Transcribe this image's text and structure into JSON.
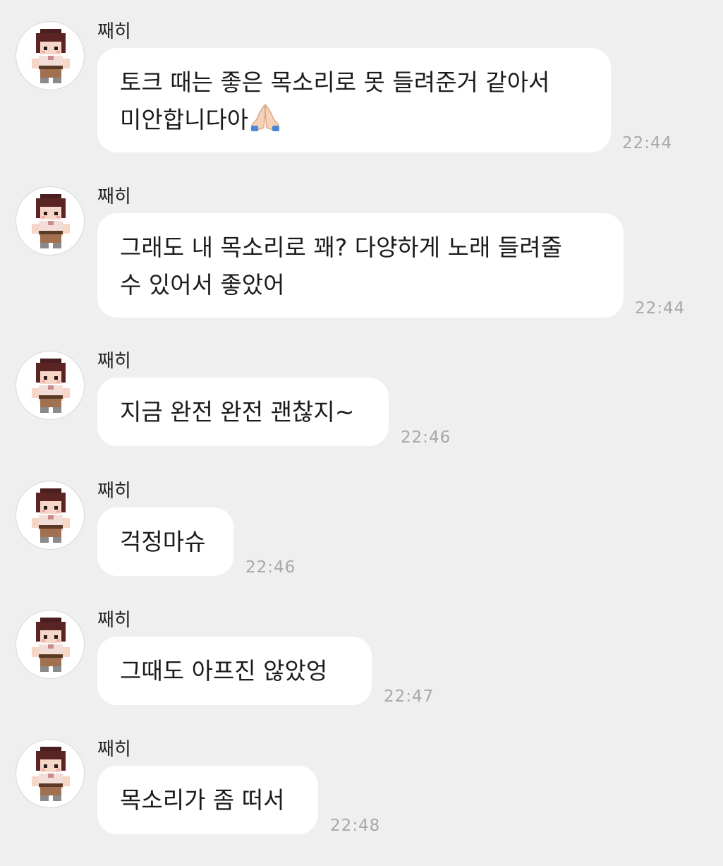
{
  "chat": {
    "sender": "째히",
    "avatar_icon": "pixel-character-avatar-icon",
    "messages": [
      {
        "line1": "토크 때는 좋은 목소리로 못 들려준거 같아서",
        "line2": "미안합니다아",
        "emoji": "folded-hands-icon",
        "time": "22:44"
      },
      {
        "line1": "그래도 내 목소리로 꽤? 다양하게 노래 들려줄",
        "line2": "수 있어서 좋았어",
        "time": "22:44"
      },
      {
        "line1": "지금 완전 완전 괜찮지~",
        "time": "22:46"
      },
      {
        "line1": "걱정마슈",
        "time": "22:46"
      },
      {
        "line1": "그때도 아프진 않았엉",
        "time": "22:47"
      },
      {
        "line1": "목소리가 좀 떠서",
        "time": "22:48"
      }
    ]
  },
  "colors": {
    "background": "#efefef",
    "bubble": "#ffffff",
    "time": "#a8a8a8"
  }
}
